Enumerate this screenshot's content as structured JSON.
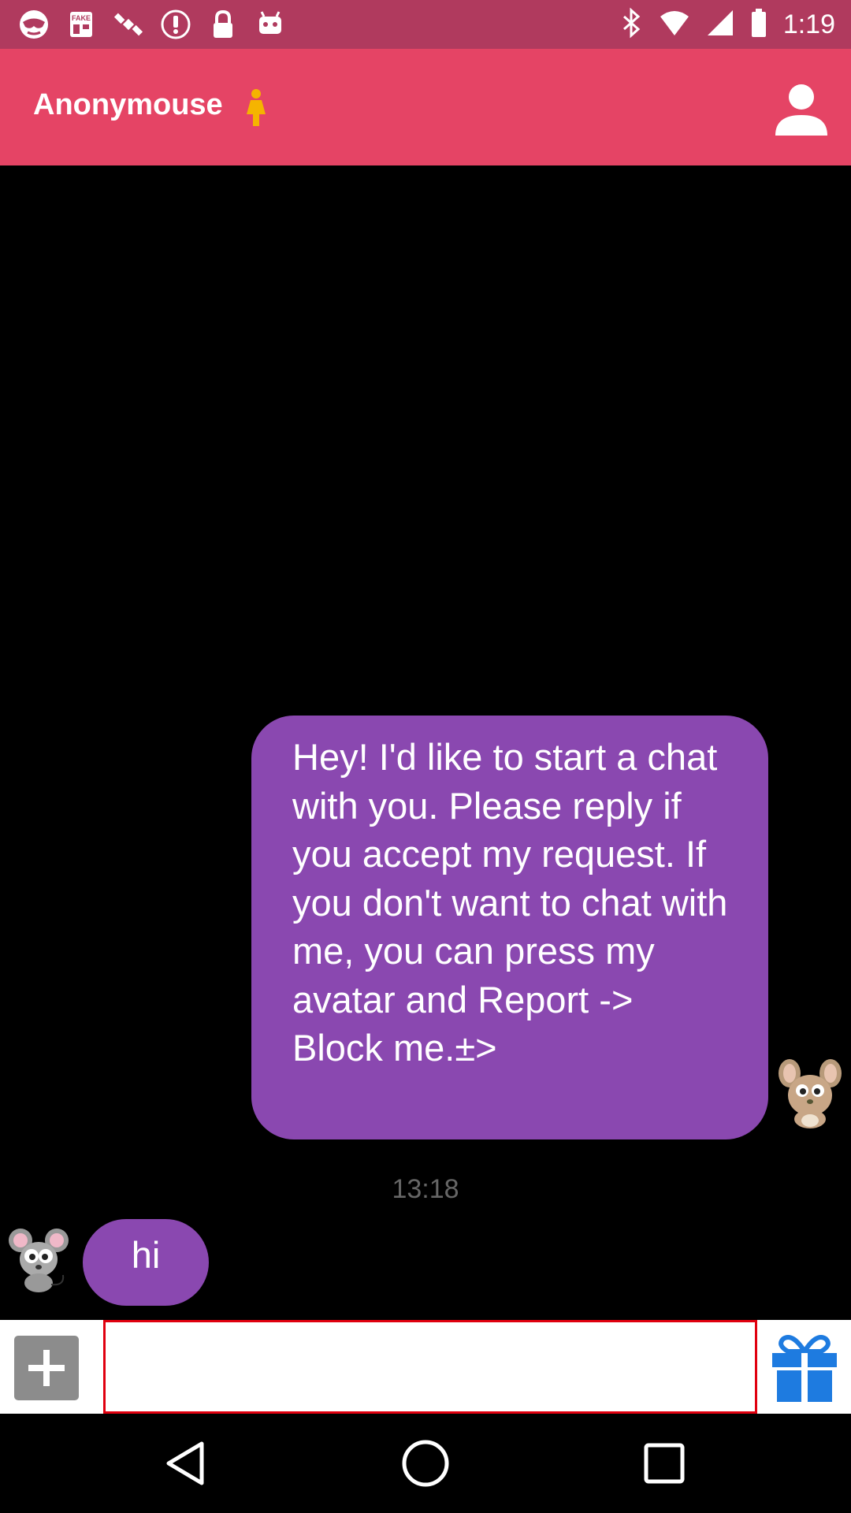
{
  "status_bar": {
    "time": "1:19",
    "left_icons": [
      "incognito-mask-icon",
      "fake-gps-icon",
      "satellite-icon",
      "alert-icon",
      "lock-icon",
      "android-icon"
    ],
    "right_icons": [
      "bluetooth-icon",
      "wifi-icon",
      "signal-icon",
      "battery-icon"
    ]
  },
  "app_bar": {
    "title": "Anonymouse",
    "gender_icon": "female-person-icon",
    "profile_icon": "person-icon"
  },
  "chat": {
    "messages": [
      {
        "direction": "outgoing",
        "text": "Hey! I'd like to start a chat with you. Please reply if you accept my request. If you don't want to chat with me, you can press my avatar and Report -> Block me.±>",
        "avatar": "bunny-mouse-avatar"
      },
      {
        "direction": "incoming",
        "text": "hi",
        "avatar": "gray-mouse-avatar"
      }
    ],
    "timestamp": "13:18"
  },
  "input_bar": {
    "add_icon": "plus-icon",
    "placeholder": "",
    "value": "",
    "gift_icon": "gift-icon"
  },
  "nav_bar": {
    "icons": [
      "back-triangle-icon",
      "home-circle-icon",
      "recents-square-icon"
    ]
  },
  "colors": {
    "status_bar": "#b03a5e",
    "app_bar": "#e54465",
    "bubble": "#8a48b0",
    "input_border": "#e0000f",
    "gift": "#1e7be0"
  }
}
